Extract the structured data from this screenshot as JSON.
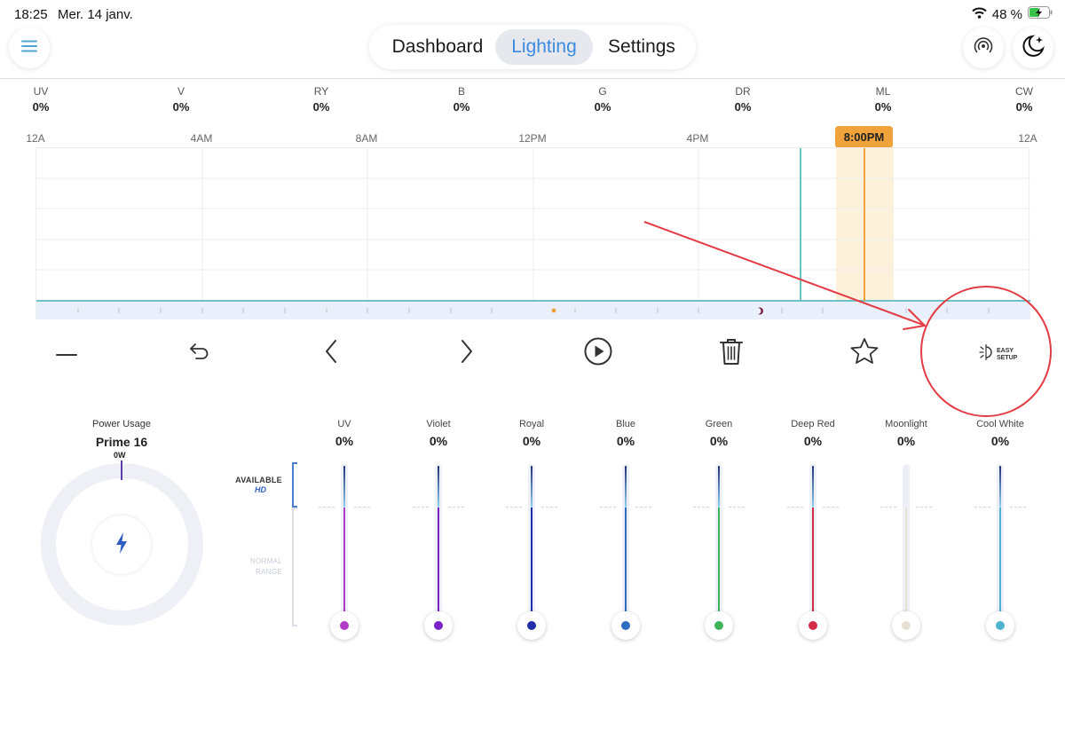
{
  "status_bar": {
    "time": "18:25",
    "date": "Mer. 14 janv.",
    "battery": "48 %"
  },
  "nav": {
    "tabs": [
      "Dashboard",
      "Lighting",
      "Settings"
    ],
    "active": "Lighting"
  },
  "header_icons": {
    "left": "menu-icon",
    "right": [
      "broadcast-icon",
      "moon-stars-icon"
    ]
  },
  "channels_summary": [
    {
      "name": "UV",
      "value": "0%"
    },
    {
      "name": "V",
      "value": "0%"
    },
    {
      "name": "RY",
      "value": "0%"
    },
    {
      "name": "B",
      "value": "0%"
    },
    {
      "name": "G",
      "value": "0%"
    },
    {
      "name": "DR",
      "value": "0%"
    },
    {
      "name": "ML",
      "value": "0%"
    },
    {
      "name": "CW",
      "value": "0%"
    }
  ],
  "timeline": {
    "labels": [
      "12A",
      "4AM",
      "8AM",
      "12PM",
      "4PM",
      "8:00PM",
      "12A"
    ],
    "current_time": "8:00PM"
  },
  "toolbar": {
    "buttons": [
      "minus-icon",
      "undo-icon",
      "chevron-left-icon",
      "chevron-right-icon",
      "play-icon",
      "trash-icon",
      "star-icon",
      "easy-setup-icon"
    ],
    "easy_setup_line1": "EASY",
    "easy_setup_line2": "SETUP"
  },
  "power": {
    "title": "Power Usage",
    "device": "Prime 16",
    "watts": "0W"
  },
  "hd_legend": {
    "available": "AVAILABLE",
    "hd": "HD",
    "normal_line1": "NORMAL",
    "normal_line2": "RANGE"
  },
  "sliders": [
    {
      "name": "UV",
      "value": "0%",
      "color": "#b23ac9"
    },
    {
      "name": "Violet",
      "value": "0%",
      "color": "#7a22c8"
    },
    {
      "name": "Royal",
      "value": "0%",
      "color": "#1f2fa8"
    },
    {
      "name": "Blue",
      "value": "0%",
      "color": "#2f6cc4"
    },
    {
      "name": "Green",
      "value": "0%",
      "color": "#3fb35a"
    },
    {
      "name": "Deep Red",
      "value": "0%",
      "color": "#d22b43"
    },
    {
      "name": "Moonlight",
      "value": "0%",
      "color": "#e6e1d2"
    },
    {
      "name": "Cool White",
      "value": "0%",
      "color": "#4fb3cf"
    }
  ],
  "colors": {
    "accent_blue": "#3b8be0",
    "time_marker": "#f0a33a",
    "cursor_line": "#6fc3c6",
    "annotation_red": "#e23c45"
  }
}
